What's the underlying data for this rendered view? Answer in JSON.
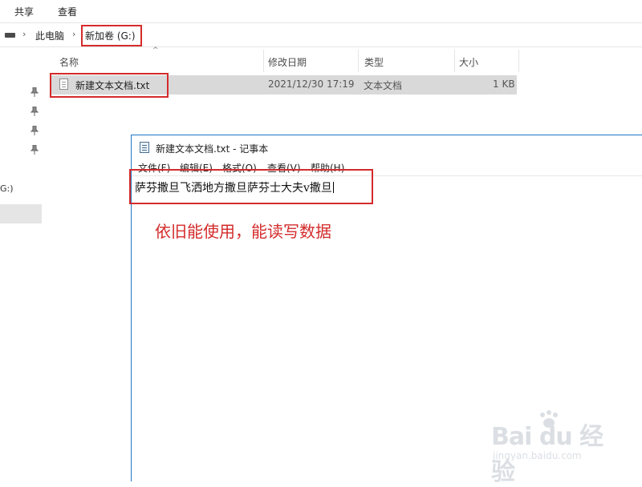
{
  "ribbon": {
    "tabs": [
      "共享",
      "查看"
    ]
  },
  "address_bar": {
    "items": [
      "此电脑",
      "新加卷 (G:)"
    ]
  },
  "nav_pane": {
    "drive_text": "G:)"
  },
  "file_list": {
    "columns": [
      "名称",
      "修改日期",
      "类型",
      "大小"
    ],
    "rows": [
      {
        "name": "新建文本文档.txt",
        "modified": "2021/12/30 17:19",
        "type": "文本文档",
        "size": "1 KB"
      }
    ]
  },
  "notepad": {
    "title": "新建文本文档.txt - 记事本",
    "menu": [
      "文件(F)",
      "编辑(E)",
      "格式(O)",
      "查看(V)",
      "帮助(H)"
    ],
    "content": "萨芬撒旦飞洒地方撒旦萨芬士大夫v撒旦"
  },
  "annotation": "依旧能使用，能读写数据",
  "watermark": {
    "logo": "Bai du 经验",
    "url": "jingyan.baidu.com"
  },
  "colors": {
    "highlight_box": "#d42b2b",
    "selection_row": "#d9d9d9",
    "window_border": "#1e78c8"
  }
}
